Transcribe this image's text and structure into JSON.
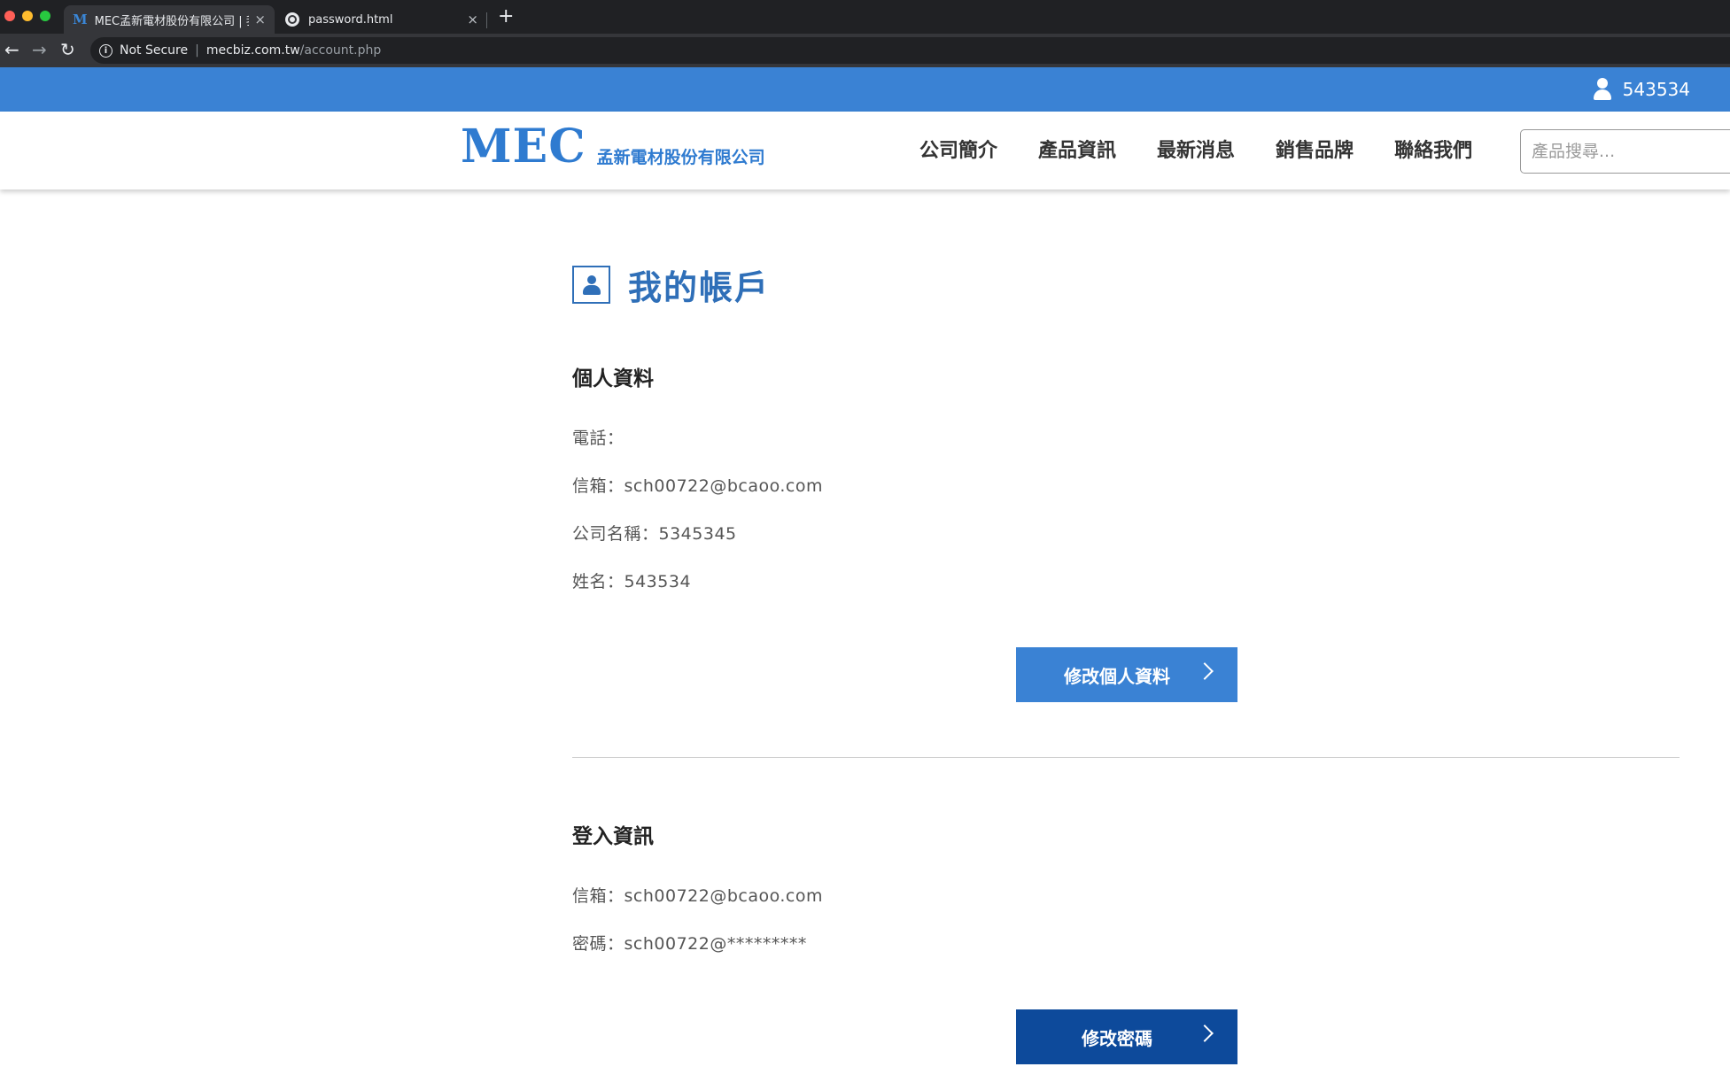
{
  "browser": {
    "tabs": [
      {
        "favicon": "M",
        "title": "MEC孟新電材股份有限公司 | 我",
        "close": "×"
      },
      {
        "favicon": "globe-icon",
        "title": "password.html",
        "close": "×"
      }
    ],
    "new_tab": "+",
    "nav": {
      "back": "←",
      "forward": "→",
      "reload": "↻"
    },
    "info_glyph": "i",
    "security": "Not Secure",
    "separator": "|",
    "url_host": "mecbiz.com.tw",
    "url_path": "/account.php"
  },
  "topbar": {
    "username": "543534",
    "color": "#3a82d4"
  },
  "header": {
    "logo_mark": "MEC",
    "logo_text": "孟新電材股份有限公司",
    "nav": [
      "公司簡介",
      "產品資訊",
      "最新消息",
      "銷售品牌",
      "聯絡我們"
    ],
    "search_placeholder": "產品搜尋..."
  },
  "main": {
    "title": "我的帳戶",
    "personal": {
      "heading": "個人資料",
      "fields": [
        "電話：",
        "信箱：sch00722@bcaoo.com",
        "公司名稱：5345345",
        "姓名：543534"
      ],
      "button": "修改個人資料",
      "button_color": "#3a82d4"
    },
    "login": {
      "heading": "登入資訊",
      "fields": [
        "信箱：sch00722@bcaoo.com",
        "密碼：sch00722@*********"
      ],
      "button": "修改密碼",
      "button_color": "#0d4a9b"
    }
  }
}
